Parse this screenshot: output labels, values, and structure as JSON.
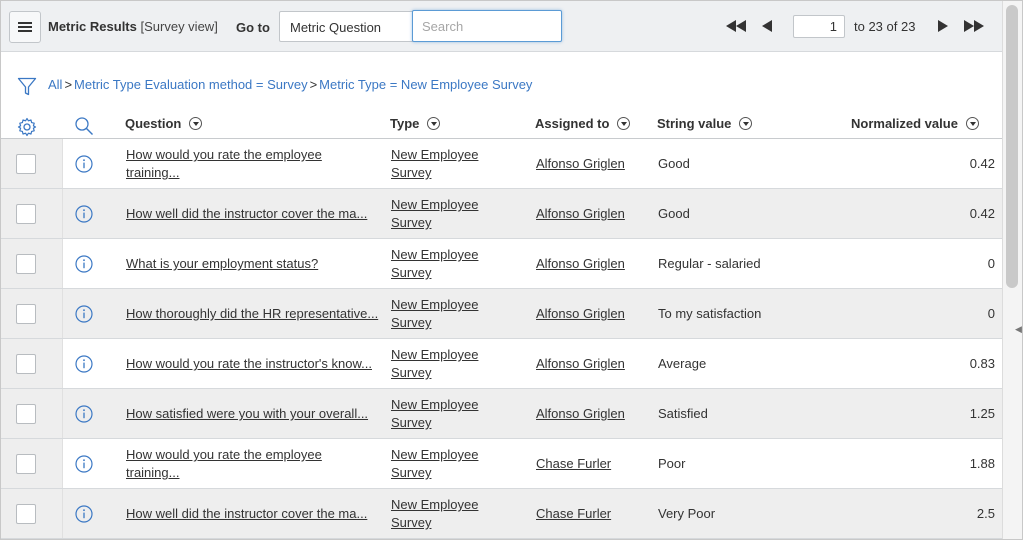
{
  "header": {
    "title": "Metric Results",
    "view": "[Survey view]",
    "goto_label": "Go to",
    "goto_select": "Metric Question",
    "search_placeholder": "Search",
    "page_current": "1",
    "page_of": "to 23 of 23"
  },
  "breadcrumb": {
    "items": [
      "All",
      "Metric Type Evaluation method = Survey",
      "Metric Type = New Employee Survey"
    ],
    "sep": ">"
  },
  "columns": {
    "question": "Question",
    "type": "Type",
    "assigned": "Assigned to",
    "string_value": "String value",
    "normalized": "Normalized value"
  },
  "rows": [
    {
      "question": [
        "How would you rate the employee",
        "training..."
      ],
      "type": [
        "New Employee",
        "Survey"
      ],
      "assigned": "Alfonso Griglen",
      "string_value": "Good",
      "normalized": "0.42"
    },
    {
      "question": [
        "How well did the instructor cover the ma...",
        ""
      ],
      "type": [
        "New Employee",
        "Survey"
      ],
      "assigned": "Alfonso Griglen",
      "string_value": "Good",
      "normalized": "0.42"
    },
    {
      "question": [
        "What is your employment status?",
        ""
      ],
      "type": [
        "New Employee",
        "Survey"
      ],
      "assigned": "Alfonso Griglen",
      "string_value": "Regular - salaried",
      "normalized": "0"
    },
    {
      "question": [
        "How thoroughly did the HR representative...",
        ""
      ],
      "type": [
        "New Employee",
        "Survey"
      ],
      "assigned": "Alfonso Griglen",
      "string_value": "To my satisfaction",
      "normalized": "0"
    },
    {
      "question": [
        "How would you rate the instructor's know...",
        ""
      ],
      "type": [
        "New Employee",
        "Survey"
      ],
      "assigned": "Alfonso Griglen",
      "string_value": "Average",
      "normalized": "0.83"
    },
    {
      "question": [
        "How satisfied were you with your overall...",
        ""
      ],
      "type": [
        "New Employee",
        "Survey"
      ],
      "assigned": "Alfonso Griglen",
      "string_value": "Satisfied",
      "normalized": "1.25"
    },
    {
      "question": [
        "How would you rate the employee",
        "training..."
      ],
      "type": [
        "New Employee",
        "Survey"
      ],
      "assigned": "Chase Furler",
      "string_value": "Poor",
      "normalized": "1.88"
    },
    {
      "question": [
        "How well did the instructor cover the ma...",
        ""
      ],
      "type": [
        "New Employee",
        "Survey"
      ],
      "assigned": "Chase Furler",
      "string_value": "Very Poor",
      "normalized": "2.5"
    }
  ],
  "colors": {
    "link_blue": "#3b78c4",
    "header_bg": "#eef0f2",
    "row_alt": "#eeeeee"
  }
}
